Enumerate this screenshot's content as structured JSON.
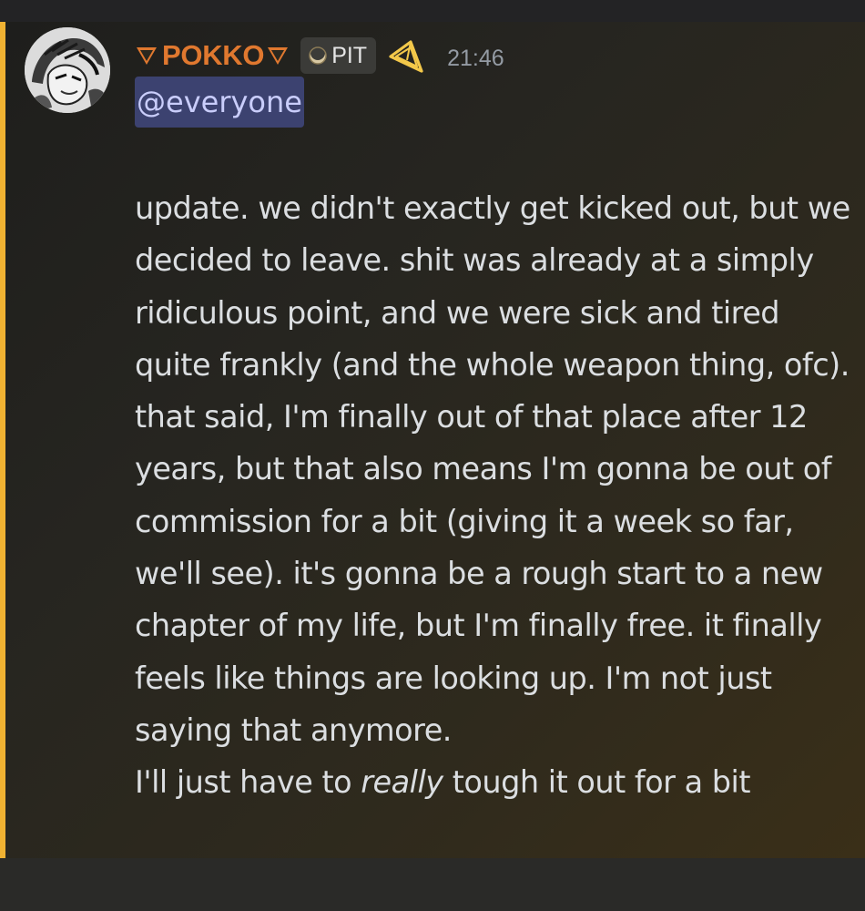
{
  "message": {
    "author": {
      "name": "POKKO",
      "name_color": "#e0782f",
      "decoration_icon": "triangle-down-icon",
      "server_tag": {
        "icon": "moon-icon",
        "text": "PIT"
      },
      "role_icon": "yellow-geometric-badge-icon"
    },
    "timestamp": "21:46",
    "mention": "@everyone",
    "mention_colors": {
      "background": "#3c4270",
      "text": "#c9cdfb"
    },
    "highlight_bar_color": "#f0b232",
    "paragraph1": "update. we didn't exactly get kicked out, but we decided to leave. shit was already at a simply ridiculous point, and we were sick and tired quite frankly (and the whole weapon thing, ofc). that said, I'm finally out of that place after 12 years, but that also means I'm gonna be out of commission for a bit (giving it a week so far, we'll see). it's gonna be a rough start to a new chapter of my life, but I'm finally free. it finally feels like things are looking up. I'm not just saying that anymore.",
    "paragraph2": {
      "before": "I'll just have to ",
      "emphasis": "really",
      "after": " tough it out for a bit"
    }
  }
}
